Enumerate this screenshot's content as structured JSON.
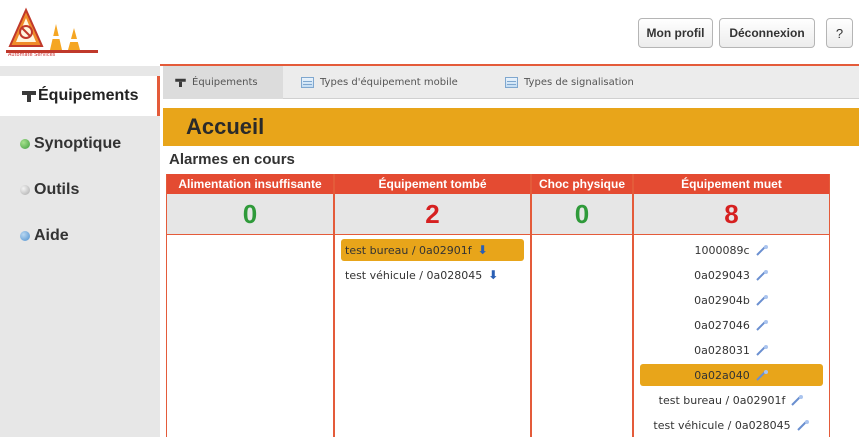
{
  "header": {
    "logo_text": "Automate Services",
    "profile_label": "Mon profil",
    "logout_label": "Déconnexion",
    "help_label": "?"
  },
  "sidebar": {
    "items": [
      {
        "label": "Équipements",
        "icon": "tools-icon",
        "active": true
      },
      {
        "label": "Synoptique",
        "icon": "green-dot-icon",
        "active": false
      },
      {
        "label": "Outils",
        "icon": "grey-dot-icon",
        "active": false
      },
      {
        "label": "Aide",
        "icon": "blue-dot-icon",
        "active": false
      }
    ]
  },
  "tabs": [
    {
      "label": "Équipements",
      "icon": "tools-icon",
      "active": true
    },
    {
      "label": "Types d'équipement mobile",
      "icon": "table-icon",
      "active": false
    },
    {
      "label": "Types de signalisation",
      "icon": "table-icon",
      "active": false
    }
  ],
  "page": {
    "title": "Accueil",
    "alarms_heading": "Alarmes en cours"
  },
  "alarms": {
    "columns": [
      {
        "header": "Alimentation insuffisante",
        "count": "0",
        "count_color": "#2f9a3a",
        "items": []
      },
      {
        "header": "Équipement tombé",
        "count": "2",
        "count_color": "#d62020",
        "items": [
          {
            "label": "test bureau / 0a02901f",
            "highlighted": true
          },
          {
            "label": "test véhicule / 0a028045",
            "highlighted": false
          }
        ]
      },
      {
        "header": "Choc physique",
        "count": "0",
        "count_color": "#2f9a3a",
        "items": []
      },
      {
        "header": "Équipement muet",
        "count": "8",
        "count_color": "#d62020",
        "items": [
          {
            "label": "1000089c",
            "highlighted": false
          },
          {
            "label": "0a029043",
            "highlighted": false
          },
          {
            "label": "0a02904b",
            "highlighted": false
          },
          {
            "label": "0a027046",
            "highlighted": false
          },
          {
            "label": "0a028031",
            "highlighted": false
          },
          {
            "label": "0a02a040",
            "highlighted": true
          },
          {
            "label": "test bureau / 0a02901f",
            "highlighted": false
          },
          {
            "label": "test véhicule / 0a028045",
            "highlighted": false
          }
        ]
      }
    ]
  },
  "colors": {
    "accent": "#e8a51a",
    "header_red": "#e44b32",
    "rule": "#e45b3a"
  }
}
